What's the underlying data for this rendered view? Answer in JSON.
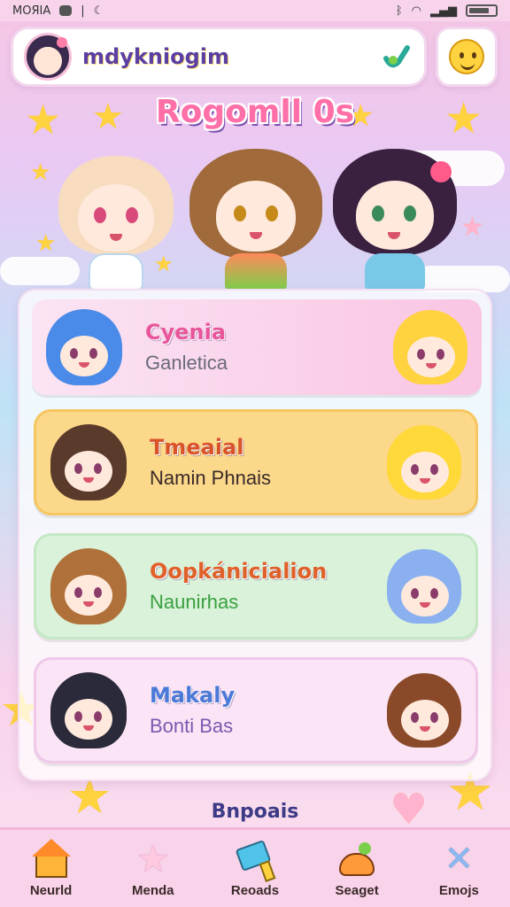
{
  "status_bar": {
    "carrier": "MOЯIA",
    "separator": "|",
    "icons": [
      "chat-icon",
      "moon-icon",
      "bluetooth-icon",
      "wifi-icon",
      "signal-icon",
      "battery-icon"
    ]
  },
  "header": {
    "search_text": "mdykniogim",
    "search_icon": "checkmark-swoosh-icon",
    "emoji_icon": "smiley-icon"
  },
  "hero": {
    "title": "Rogomll 0s"
  },
  "cards": [
    {
      "name": "Cyenia",
      "subtitle": "Ganletica",
      "name_color": "#e8559a",
      "sub_color": "#6a6a7a"
    },
    {
      "name": "Tmeaial",
      "subtitle": "Namin Phnais",
      "name_color": "#d9532a",
      "sub_color": "#3a2a2a"
    },
    {
      "name": "Oopkánicialion",
      "subtitle": "Naunirhas",
      "name_color": "#e0602a",
      "sub_color": "#3aa040"
    },
    {
      "name": "Makaly",
      "subtitle": "Bonti Bas",
      "name_color": "#4a7ad8",
      "sub_color": "#7a5ab0"
    }
  ],
  "section_label": "Bnpoais",
  "bottom_nav": [
    {
      "label": "Neurld",
      "icon": "house-icon"
    },
    {
      "label": "Menda",
      "icon": "star-icon"
    },
    {
      "label": "Reoads",
      "icon": "paint-brush-icon"
    },
    {
      "label": "Seaget",
      "icon": "food-icon"
    },
    {
      "label": "Emojs",
      "icon": "sparkle-x-icon"
    }
  ]
}
